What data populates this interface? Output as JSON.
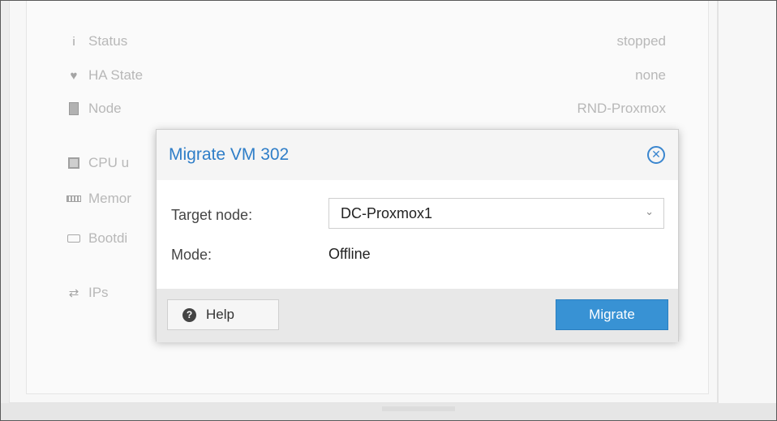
{
  "status_panel": {
    "rows": [
      {
        "label": "Status",
        "value": "stopped",
        "icon": "info-icon"
      },
      {
        "label": "HA State",
        "value": "none",
        "icon": "heartbeat-icon"
      },
      {
        "label": "Node",
        "value": "RND-Proxmox",
        "icon": "server-icon"
      },
      {
        "label": "CPU u",
        "value": "",
        "icon": "cpu-icon"
      },
      {
        "label": "Memor",
        "value": "",
        "icon": "memory-icon"
      },
      {
        "label": "Bootdi",
        "value": "",
        "icon": "disk-icon"
      },
      {
        "label": "IPs",
        "value": "",
        "icon": "network-icon"
      }
    ]
  },
  "dialog": {
    "title": "Migrate VM 302",
    "close_icon": "close-circle-icon",
    "target_node_label": "Target node:",
    "target_node_value": "DC-Proxmox1",
    "mode_label": "Mode:",
    "mode_value": "Offline",
    "help_label": "Help",
    "migrate_label": "Migrate"
  },
  "colors": {
    "accent": "#3892d4",
    "title": "#2f7ec8"
  }
}
